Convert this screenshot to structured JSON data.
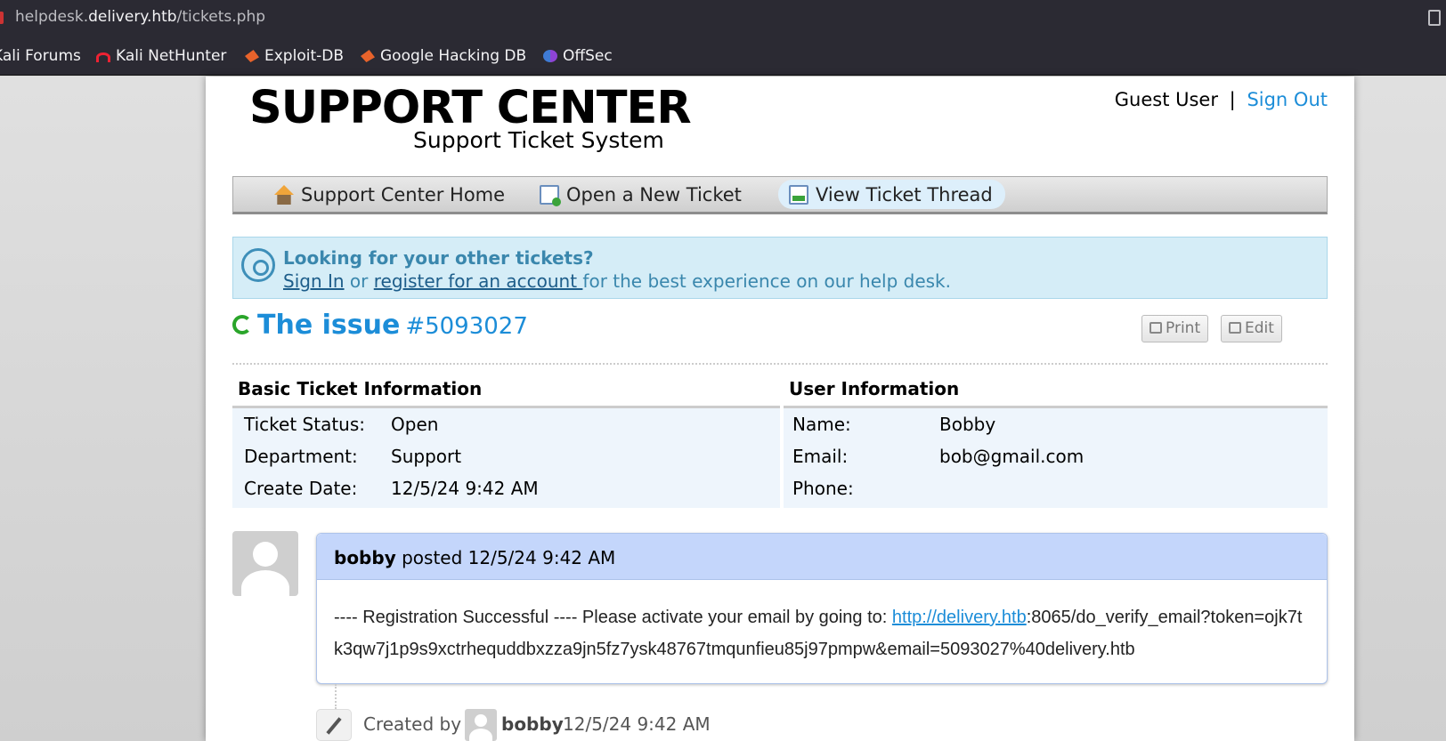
{
  "browser": {
    "url_prefix": "helpdesk.",
    "url_host": "delivery.htb",
    "url_path": "/tickets.php",
    "bookmarks": [
      "Kali Forums",
      "Kali NetHunter",
      "Exploit-DB",
      "Google Hacking DB",
      "OffSec"
    ]
  },
  "header": {
    "logo_title": "SUPPORT CENTER",
    "logo_subtitle": "Support Ticket System",
    "user": "Guest User",
    "separator": "|",
    "signout": "Sign Out"
  },
  "nav": {
    "items": [
      "Support Center Home",
      "Open a New Ticket",
      "View Ticket Thread"
    ],
    "active": "View Ticket Thread"
  },
  "notice": {
    "heading": "Looking for your other tickets?",
    "signin": "Sign In",
    "or": " or ",
    "register": "register for an account ",
    "tail": "for the best experience on our help desk."
  },
  "ticket": {
    "subject": "The issue",
    "number": "#5093027",
    "print": "Print",
    "edit": "Edit"
  },
  "basic_info": {
    "title": "Basic Ticket Information",
    "rows": [
      {
        "label": "Ticket Status:",
        "value": "Open"
      },
      {
        "label": "Department:",
        "value": "Support"
      },
      {
        "label": "Create Date:",
        "value": "12/5/24 9:42 AM"
      }
    ]
  },
  "user_info": {
    "title": "User Information",
    "rows": [
      {
        "label": "Name:",
        "value": "Bobby"
      },
      {
        "label": "Email:",
        "value": "bob@gmail.com"
      },
      {
        "label": "Phone:",
        "value": ""
      }
    ]
  },
  "post": {
    "author": "bobby",
    "posted": " posted 12/5/24 9:42 AM",
    "body_pre": "---- Registration Successful ---- Please activate your email by going to: ",
    "body_link": "http://delivery.htb",
    "body_post": ":8065/do_verify_email?token=ojk7tk3qw7j1p9s9xctrhequddbxzza9jn5fz7ysk48767tmqunfieu85j97pmpw&email=5093027%40delivery.htb"
  },
  "event": {
    "label": "Created by",
    "author": "bobby",
    "time": "12/5/24 9:42 AM"
  }
}
